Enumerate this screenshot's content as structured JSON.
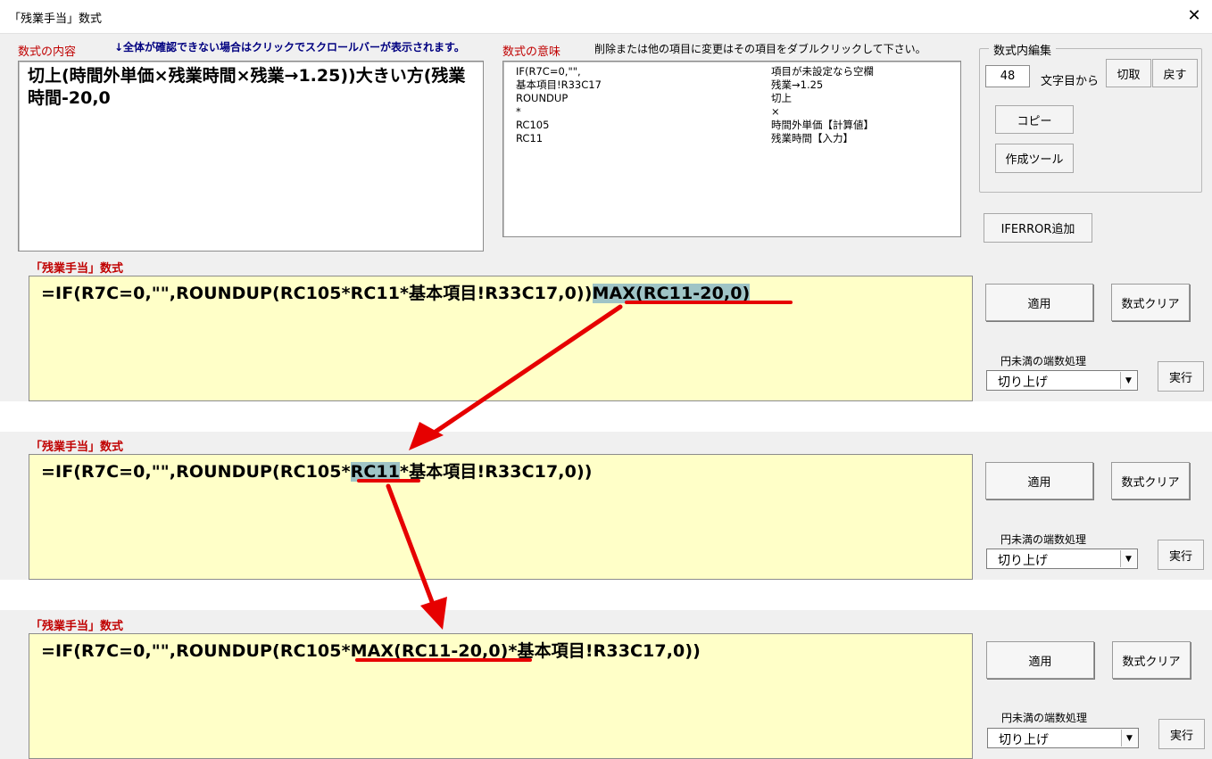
{
  "window": {
    "title": "「残業手当」数式",
    "close_glyph": "✕"
  },
  "content_section": {
    "label": "数式の内容",
    "note": "↓全体が確認できない場合はクリックでスクロールバーが表示されます。",
    "text": "切上(時間外単価×残業時間×残業→1.25))大きい方(残業時間-20,0"
  },
  "meaning_section": {
    "label": "数式の意味",
    "note": "削除または他の項目に変更はその項目をダブルクリックして下さい。",
    "rows": [
      {
        "code": "IF(R7C=0,\"\",",
        "meaning": "項目が未設定なら空欄"
      },
      {
        "code": "基本項目!R33C17",
        "meaning": "残業→1.25"
      },
      {
        "code": "ROUNDUP",
        "meaning": "切上"
      },
      {
        "code": "*",
        "meaning": "×"
      },
      {
        "code": "RC105",
        "meaning": "時間外単価【計算値】"
      },
      {
        "code": "RC11",
        "meaning": "残業時間【入力】"
      }
    ]
  },
  "edit_group": {
    "legend": "数式内編集",
    "position_value": "48",
    "position_suffix": "文字目から",
    "cut_label": "切取",
    "undo_label": "戻す",
    "copy_label": "コピー",
    "tool_label": "作成ツール"
  },
  "iferror_label": "IFERROR追加",
  "panels": [
    {
      "label": "「残業手当」数式",
      "formula_before": "=IF(R7C=0,\"\",ROUNDUP(RC105*RC11*基本項目!R33C17,0))",
      "formula_highlight": "MAX(RC11-20,0)",
      "formula_after": "",
      "apply_label": "適用",
      "clear_label": "数式クリア",
      "rounding_label": "円未満の端数処理",
      "rounding_value": "切り上げ",
      "run_label": "実行"
    },
    {
      "label": "「残業手当」数式",
      "formula_before": "=IF(R7C=0,\"\",ROUNDUP(RC105*",
      "formula_highlight": "RC11",
      "formula_after": "*基本項目!R33C17,0))",
      "apply_label": "適用",
      "clear_label": "数式クリア",
      "rounding_label": "円未満の端数処理",
      "rounding_value": "切り上げ",
      "run_label": "実行"
    },
    {
      "label": "「残業手当」数式",
      "formula_before": "=IF(R7C=0,\"\",ROUNDUP(RC105*",
      "formula_highlight": "MAX(RC11-20,0)",
      "formula_after": "*基本項目!R33C17,0))",
      "apply_label": "適用",
      "clear_label": "数式クリア",
      "rounding_label": "円未満の端数処理",
      "rounding_value": "切り上げ",
      "run_label": "実行"
    }
  ],
  "colors": {
    "label_red": "#c00000",
    "note_navy": "#000080",
    "formula_bg": "#ffffc8",
    "highlight": "#9fc4c6",
    "annotation_red": "#e60000"
  }
}
